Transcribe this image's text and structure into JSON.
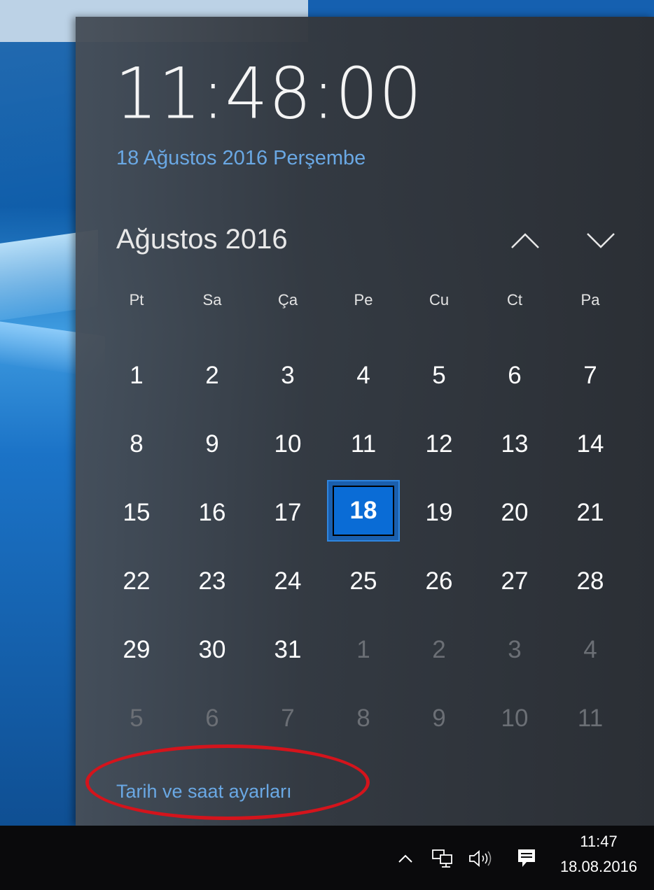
{
  "flyout": {
    "time": "11:48:00",
    "long_date": "18 Ağustos 2016 Perşembe",
    "month_title": "Ağustos 2016",
    "nav": {
      "up_icon": "chevron-up-icon",
      "down_icon": "chevron-down-icon"
    },
    "weekdays": [
      "Pt",
      "Sa",
      "Ça",
      "Pe",
      "Cu",
      "Ct",
      "Pa"
    ],
    "weeks": [
      [
        {
          "d": "1"
        },
        {
          "d": "2"
        },
        {
          "d": "3"
        },
        {
          "d": "4"
        },
        {
          "d": "5"
        },
        {
          "d": "6"
        },
        {
          "d": "7"
        }
      ],
      [
        {
          "d": "8"
        },
        {
          "d": "9"
        },
        {
          "d": "10"
        },
        {
          "d": "11"
        },
        {
          "d": "12"
        },
        {
          "d": "13"
        },
        {
          "d": "14"
        }
      ],
      [
        {
          "d": "15"
        },
        {
          "d": "16"
        },
        {
          "d": "17"
        },
        {
          "d": "18",
          "today": true
        },
        {
          "d": "19"
        },
        {
          "d": "20"
        },
        {
          "d": "21"
        }
      ],
      [
        {
          "d": "22"
        },
        {
          "d": "23"
        },
        {
          "d": "24"
        },
        {
          "d": "25"
        },
        {
          "d": "26"
        },
        {
          "d": "27"
        },
        {
          "d": "28"
        }
      ],
      [
        {
          "d": "29"
        },
        {
          "d": "30"
        },
        {
          "d": "31"
        },
        {
          "d": "1",
          "other": true
        },
        {
          "d": "2",
          "other": true
        },
        {
          "d": "3",
          "other": true
        },
        {
          "d": "4",
          "other": true
        }
      ],
      [
        {
          "d": "5",
          "other": true
        },
        {
          "d": "6",
          "other": true
        },
        {
          "d": "7",
          "other": true
        },
        {
          "d": "8",
          "other": true
        },
        {
          "d": "9",
          "other": true
        },
        {
          "d": "10",
          "other": true
        },
        {
          "d": "11",
          "other": true
        }
      ]
    ],
    "settings_link": "Tarih ve saat ayarları",
    "colors": {
      "accent": "#6aa8e4",
      "today_fill": "#0a6cd6",
      "annotation": "#d4141c"
    }
  },
  "taskbar": {
    "tray_icons": [
      "chevron-up-icon",
      "network-icon",
      "volume-icon",
      "action-center-icon"
    ],
    "time": "11:47",
    "date": "18.08.2016"
  }
}
